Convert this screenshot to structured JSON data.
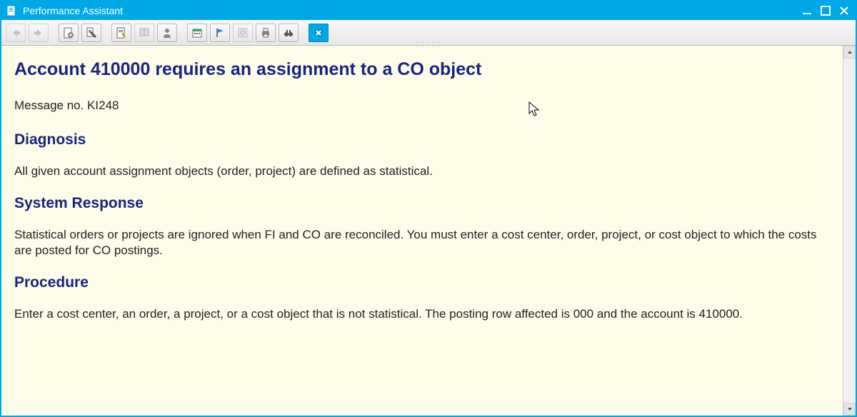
{
  "window": {
    "title": "Performance Assistant",
    "icons": {
      "app": "document-icon",
      "minimize": "minimize-icon",
      "maximize": "maximize-icon",
      "close": "close-icon"
    }
  },
  "toolbar": {
    "buttons": [
      {
        "name": "nav-back-button",
        "icon": "arrow-left-icon",
        "disabled": true
      },
      {
        "name": "nav-forward-button",
        "icon": "arrow-right-icon",
        "disabled": true
      },
      {
        "name": "technical-info-button",
        "icon": "page-gear-icon"
      },
      {
        "name": "customize-local-layout-button",
        "icon": "wrench-page-icon"
      },
      {
        "name": "edit-document-button",
        "icon": "page-pencil-icon"
      },
      {
        "name": "application-help-button",
        "icon": "book-icon"
      },
      {
        "name": "user-button",
        "icon": "person-icon"
      },
      {
        "name": "calendar-button",
        "icon": "calendar-icon"
      },
      {
        "name": "flag-button",
        "icon": "flag-icon"
      },
      {
        "name": "settings-button",
        "icon": "gear-box-icon"
      },
      {
        "name": "print-button",
        "icon": "printer-icon"
      },
      {
        "name": "find-button",
        "icon": "binoculars-icon"
      },
      {
        "name": "close-help-button",
        "icon": "x-box-icon",
        "active": true
      }
    ]
  },
  "content": {
    "title": "Account 410000 requires an assignment to a CO object",
    "message_no_label": "Message no. KI248",
    "sections": [
      {
        "heading": "Diagnosis",
        "text": "All given account assignment objects (order, project) are defined as statistical."
      },
      {
        "heading": "System Response",
        "text": "Statistical orders or projects are ignored when FI and CO are reconciled. You must enter a cost center, order, project, or cost object to which the costs are posted for CO postings."
      },
      {
        "heading": "Procedure",
        "text": "Enter a cost center, an order, a project, or a cost object that is not statistical. The posting row affected is 000 and the account is 410000."
      }
    ]
  }
}
